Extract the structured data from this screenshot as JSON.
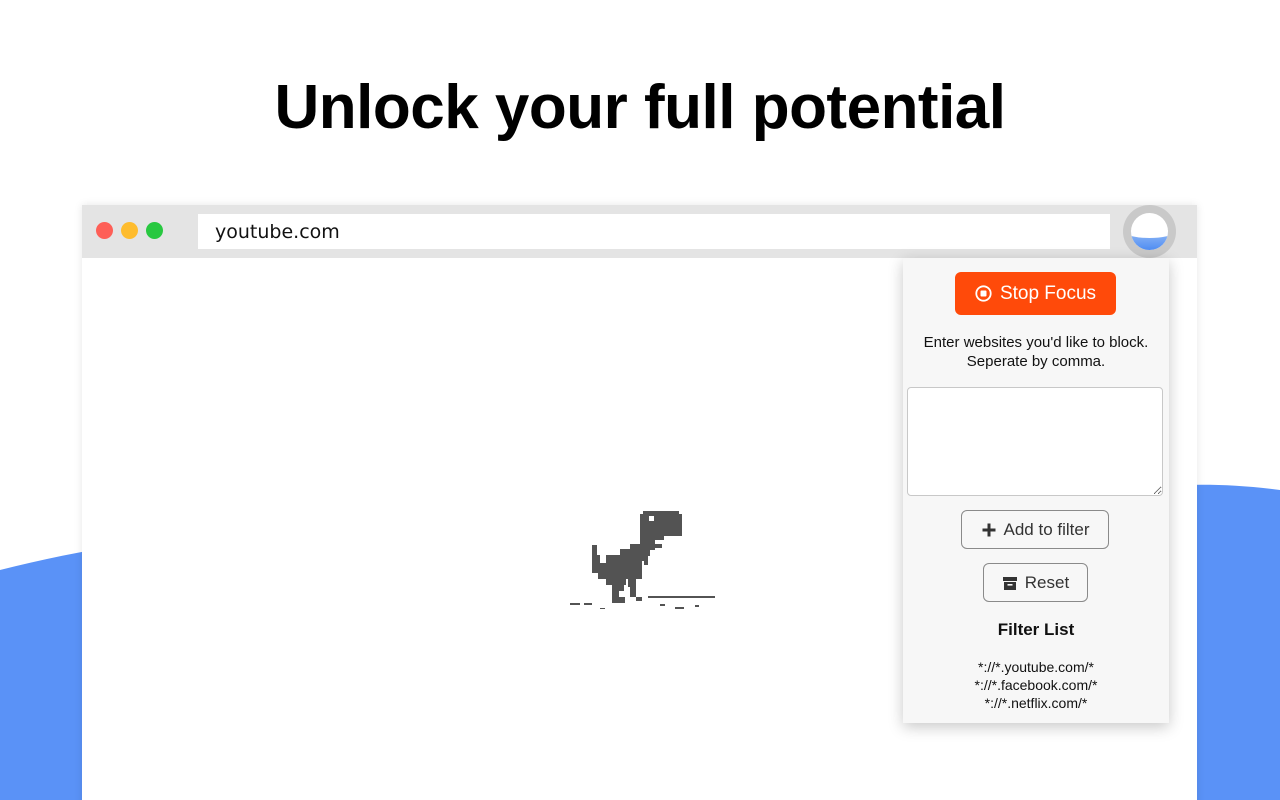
{
  "headline": "Unlock your full potential",
  "colors": {
    "background": "#ffffff",
    "wave_accent": "#5a92f7",
    "titlebar": "#e4e4e4",
    "stop_button": "#ff4a0a",
    "dino": "#535353"
  },
  "browser": {
    "window_controls": [
      "close-dot",
      "minimize-dot",
      "maximize-dot"
    ],
    "url": "youtube.com",
    "extension_icon": "water-globe-icon"
  },
  "page_content": {
    "graphic": "offline-dinosaur"
  },
  "popup": {
    "stop_button_label": "Stop Focus",
    "stop_button_icon": "stop-circle-icon",
    "instructions_line1": "Enter websites you'd like to block.",
    "instructions_line2": "Seperate by comma.",
    "textarea_value": "",
    "add_button_label": "Add to filter",
    "add_button_icon": "plus-icon",
    "reset_button_label": "Reset",
    "reset_button_icon": "archive-box-icon",
    "filter_list_title": "Filter List",
    "filter_list": [
      "*://*.youtube.com/*",
      "*://*.facebook.com/*",
      "*://*.netflix.com/*"
    ]
  }
}
